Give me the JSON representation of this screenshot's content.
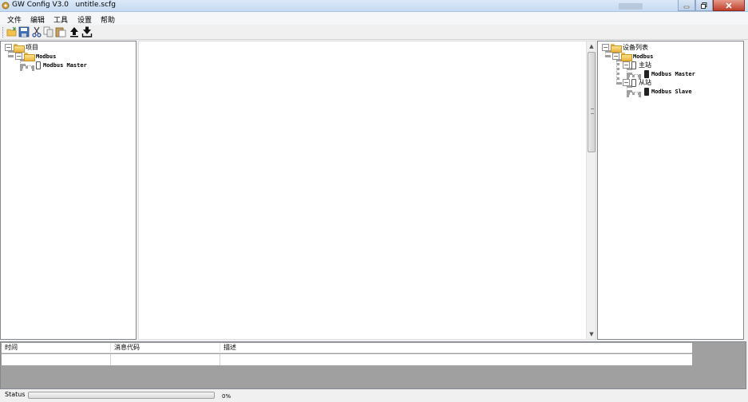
{
  "window": {
    "title": "GW Config V3.0   untitle.scfg",
    "icon": "app-gear-icon"
  },
  "menu": {
    "items": [
      {
        "label": "文件"
      },
      {
        "label": "编辑"
      },
      {
        "label": "工具"
      },
      {
        "label": "设置"
      },
      {
        "label": "帮助"
      }
    ]
  },
  "toolbar": {
    "buttons": [
      "open-folder-icon",
      "save-icon",
      "cut-icon",
      "copy-icon",
      "paste-icon",
      "upload-icon",
      "download-icon"
    ]
  },
  "project_tree": {
    "root": "项目",
    "child": "Modbus",
    "leaf": "Modbus Master"
  },
  "device_tree": {
    "root": "设备列表",
    "child": "Modbus",
    "master_group": "主站",
    "master_leaf": "Modbus Master",
    "slave_group": "从站",
    "slave_leaf": "Modbus Slave"
  },
  "messages": {
    "columns": [
      "时间",
      "消息代码",
      "描述"
    ],
    "rows": [
      [
        "",
        "",
        ""
      ]
    ]
  },
  "status": {
    "label": "Status",
    "progress_fraction": 0,
    "percent_text": "0%"
  },
  "colors": {
    "progress_green": "#06b025",
    "folder_yellow": "#e9b33b"
  }
}
